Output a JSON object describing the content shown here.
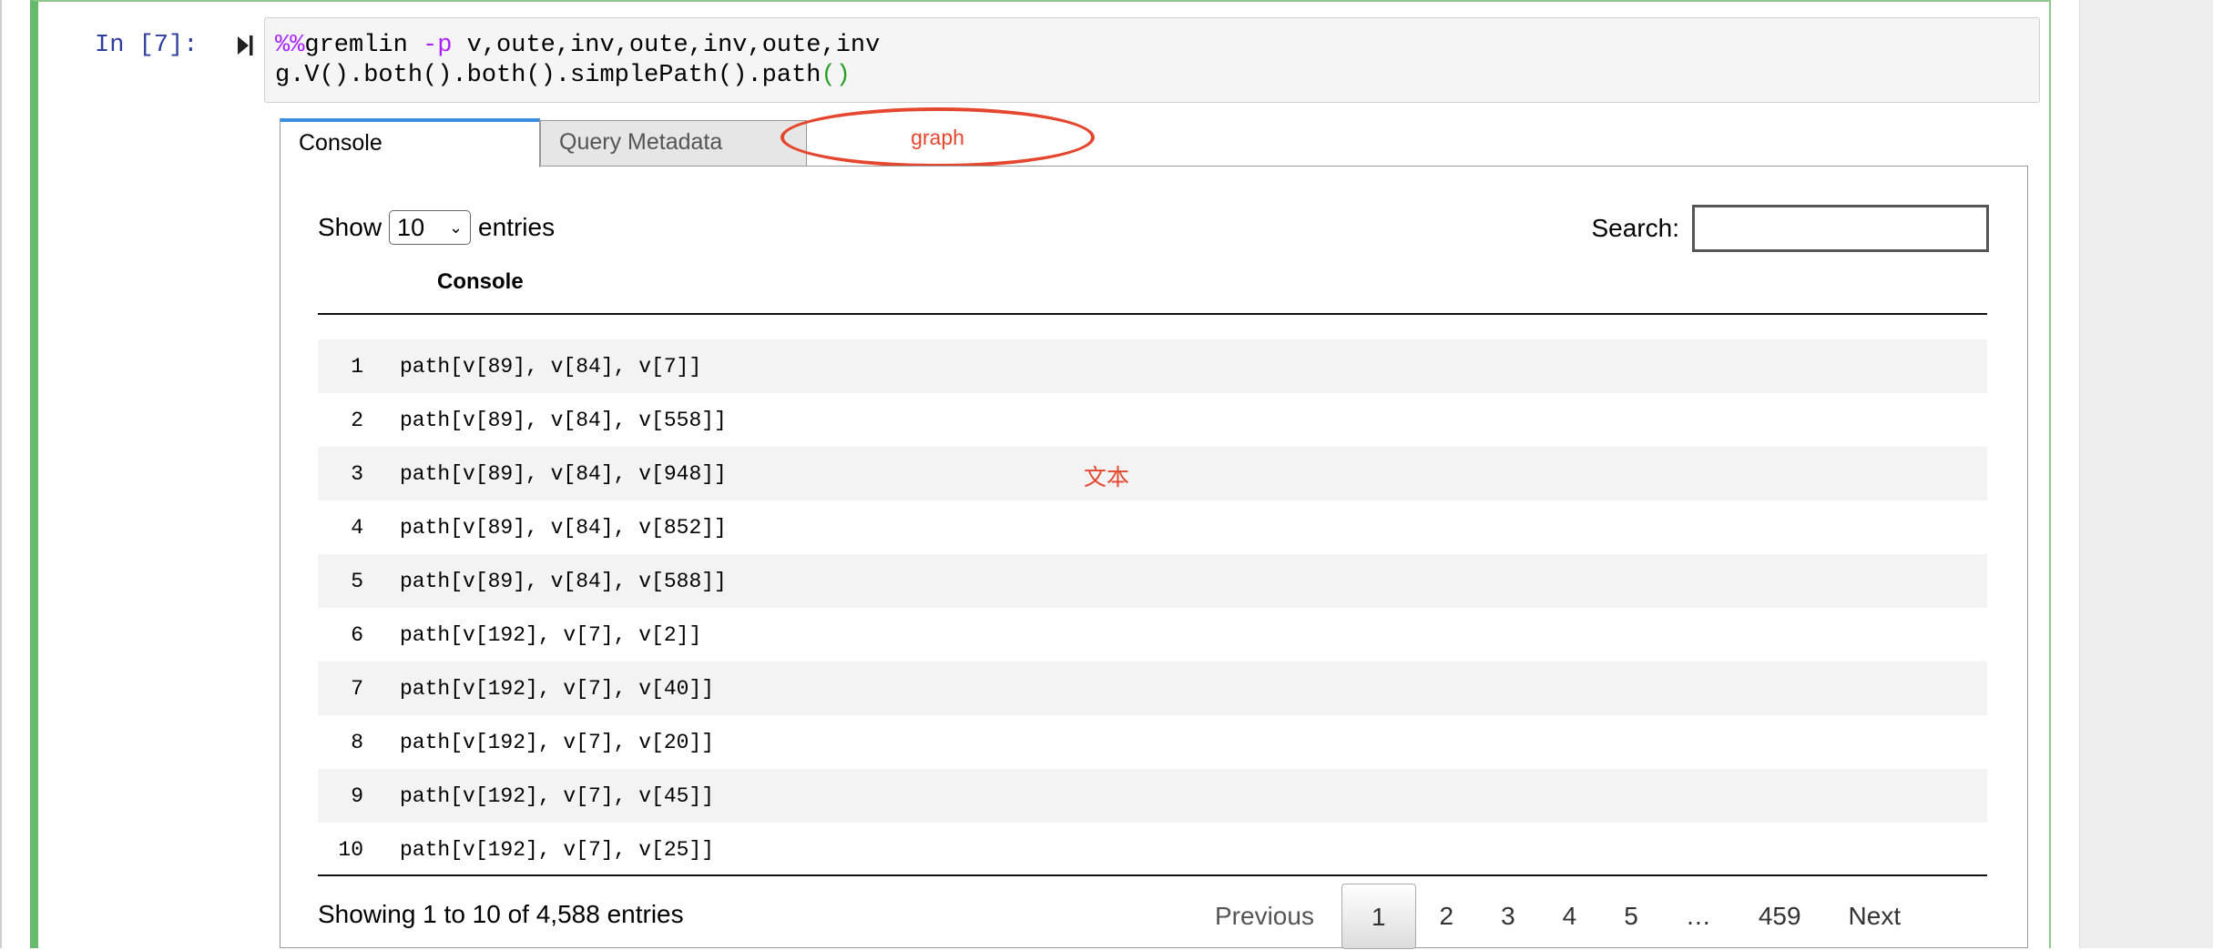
{
  "cell": {
    "prompt": "In [7]:",
    "code_line1_magic": "%%",
    "code_line1_cmd": "gremlin ",
    "code_line1_flag": "-p",
    "code_line1_args": " v,oute,inv,oute,inv,oute,inv",
    "code_line2_main": "g.V().both().both().simplePath().path",
    "code_line2_paren": "()"
  },
  "tabs": {
    "console": "Console",
    "query_metadata": "Query Metadata",
    "graph_annotation": "graph"
  },
  "table": {
    "show_label": "Show",
    "entries_value": "10",
    "entries_label": "entries",
    "search_label": "Search:",
    "column_header": "Console",
    "rows": [
      {
        "idx": "1",
        "val": "path[v[89], v[84], v[7]]"
      },
      {
        "idx": "2",
        "val": "path[v[89], v[84], v[558]]"
      },
      {
        "idx": "3",
        "val": "path[v[89], v[84], v[948]]"
      },
      {
        "idx": "4",
        "val": "path[v[89], v[84], v[852]]"
      },
      {
        "idx": "5",
        "val": "path[v[89], v[84], v[588]]"
      },
      {
        "idx": "6",
        "val": "path[v[192], v[7], v[2]]"
      },
      {
        "idx": "7",
        "val": "path[v[192], v[7], v[40]]"
      },
      {
        "idx": "8",
        "val": "path[v[192], v[7], v[20]]"
      },
      {
        "idx": "9",
        "val": "path[v[192], v[7], v[45]]"
      },
      {
        "idx": "10",
        "val": "path[v[192], v[7], v[25]]"
      }
    ],
    "info": "Showing 1 to 10 of 4,588 entries"
  },
  "pagination": {
    "previous": "Previous",
    "pages": [
      "1",
      "2",
      "3",
      "4",
      "5"
    ],
    "ellipsis": "…",
    "last": "459",
    "next": "Next"
  },
  "annotation_text": "文本",
  "colors": {
    "accent": "#3c8ee0",
    "cell_border": "#66bb6a",
    "annotation": "#e5462e",
    "prompt": "#303f9f"
  }
}
